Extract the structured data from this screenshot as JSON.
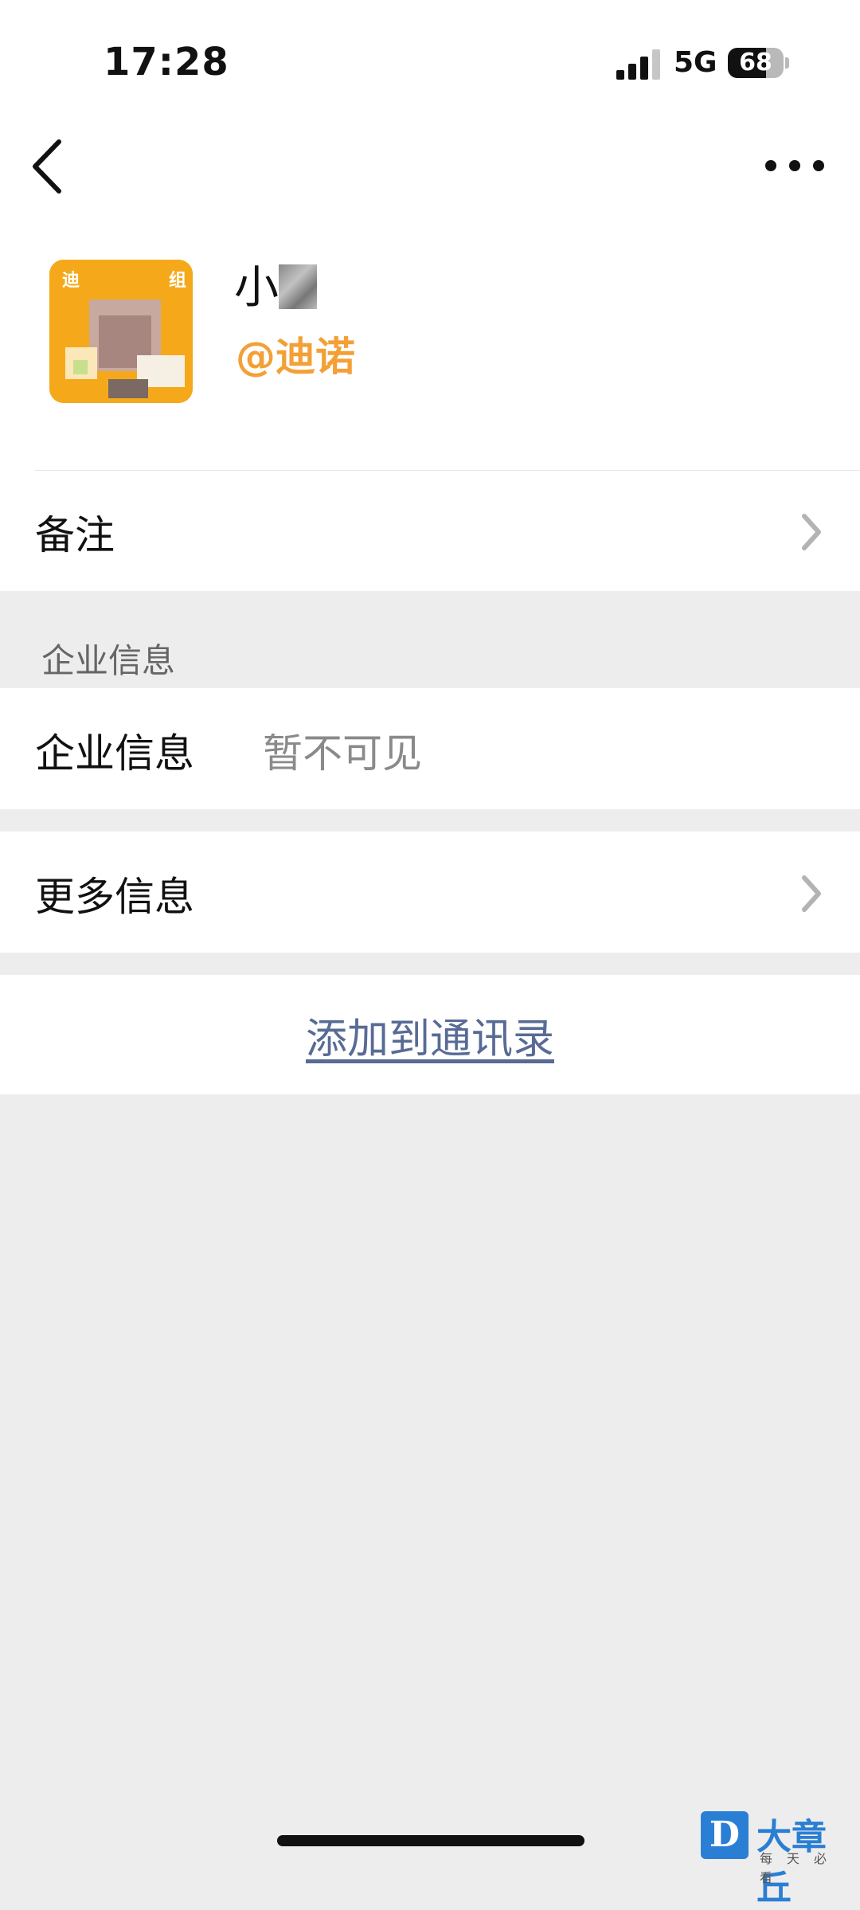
{
  "status_bar": {
    "time": "17:28",
    "network": "5G",
    "battery_level": "68",
    "battery_fraction": 0.68
  },
  "nav": {
    "back_icon": "chevron-left-icon",
    "more_icon": "ellipsis-icon"
  },
  "profile": {
    "name": "小",
    "corp_tag": "@迪诺",
    "avatar_text": "迪",
    "avatar_text_right": "组"
  },
  "rows": {
    "remark_label": "备注",
    "enterprise_section_header": "企业信息",
    "enterprise_label": "企业信息",
    "enterprise_value": "暂不可见",
    "more_info_label": "更多信息",
    "add_contact_label": "添加到通讯录"
  },
  "watermark": {
    "logo_letter": "D",
    "title": "大章丘",
    "subtitle": "每天必看"
  },
  "colors": {
    "background": "#ededed",
    "corp_tag": "#f3a037",
    "link": "#576b95",
    "watermark": "#2a7fd4"
  }
}
